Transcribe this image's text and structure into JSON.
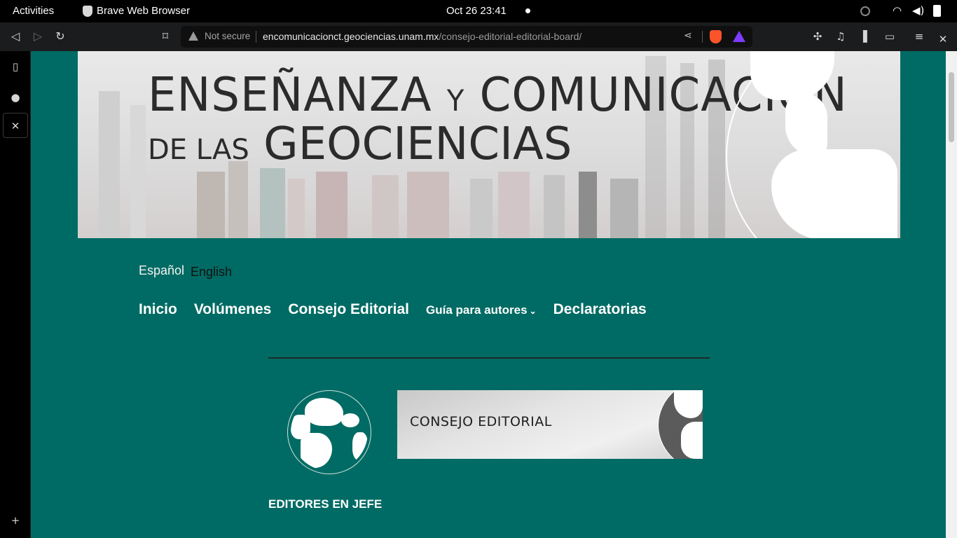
{
  "topbar": {
    "activities": "Activities",
    "app_name": "Brave Web Browser",
    "clock": "Oct 26  23:41"
  },
  "browser": {
    "security_label": "Not secure",
    "url_host": "encomunicacionct.geociencias.unam.mx",
    "url_path": "/consejo-editorial-editorial-board/"
  },
  "banner": {
    "line1_a": "ENSEÑANZA",
    "line1_b": "Y",
    "line1_c": "COMUNICACIÓN",
    "line2_a": "DE LAS",
    "line2_b": "GEOCIENCIAS"
  },
  "languages": {
    "es": "Español",
    "en": "English"
  },
  "nav": {
    "inicio": "Inicio",
    "volumenes": "Volúmenes",
    "consejo": "Consejo Editorial",
    "guia": "Guía para autores",
    "declaratorias": "Declaratorias"
  },
  "content": {
    "section_banner_label": "CONSEJO EDITORIAL",
    "editores_heading": "EDITORES EN JEFE"
  },
  "colors": {
    "page_bg": "#006b64",
    "brave_orange": "#fb542b"
  }
}
